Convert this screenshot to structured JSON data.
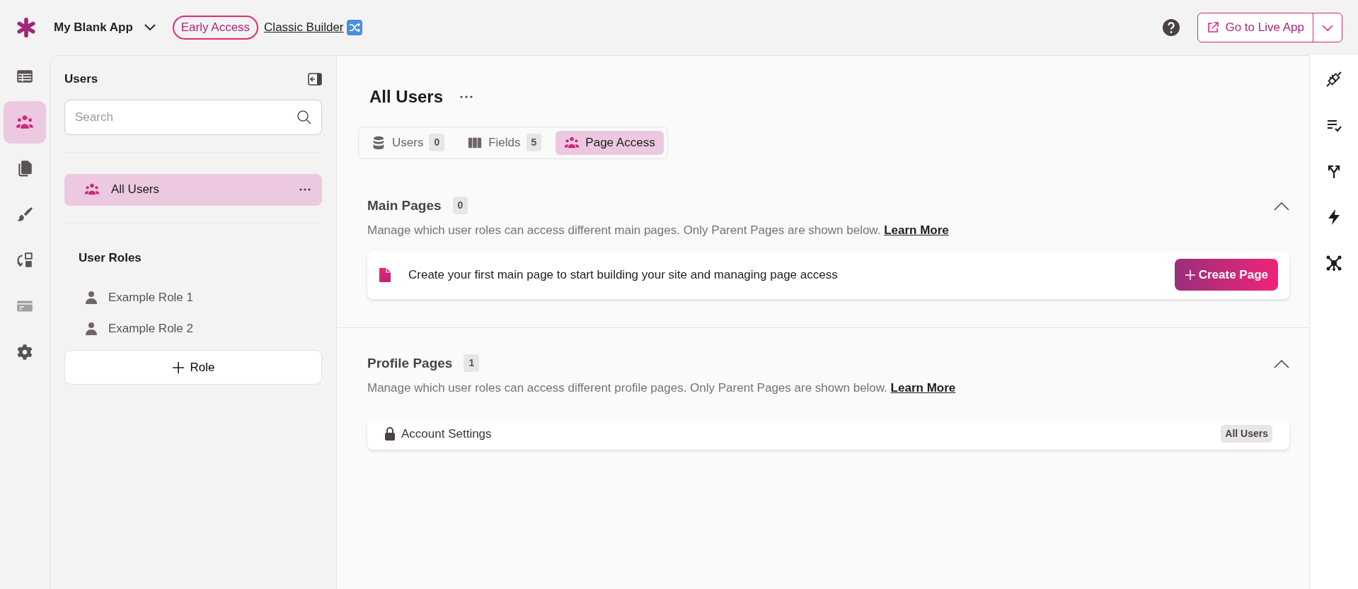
{
  "header": {
    "app_name": "My Blank App",
    "badge": "Early Access",
    "classic_link": "Classic Builder",
    "live_button": "Go to Live App"
  },
  "left_rail": [
    {
      "kind": "table",
      "selected": false
    },
    {
      "kind": "users",
      "selected": true
    },
    {
      "kind": "pages",
      "selected": false
    },
    {
      "kind": "brush",
      "selected": false
    },
    {
      "kind": "flows",
      "selected": false
    },
    {
      "kind": "card",
      "selected": false
    },
    {
      "kind": "gear",
      "selected": false
    }
  ],
  "sidebar": {
    "title": "Users",
    "search": {
      "placeholder": "Search"
    },
    "groups": [
      {
        "label": "All Users",
        "selected": true
      }
    ],
    "roles_title": "User Roles",
    "roles": [
      {
        "label": "Example Role 1"
      },
      {
        "label": "Example Role 2"
      }
    ],
    "add_role": "Role"
  },
  "main": {
    "title": "All Users",
    "tabs": [
      {
        "kind": "database",
        "label": "Users",
        "count": "0",
        "selected": false
      },
      {
        "kind": "columns",
        "label": "Fields",
        "count": "5",
        "selected": false
      },
      {
        "kind": "users",
        "label": "Page Access",
        "selected": true
      }
    ],
    "sections": [
      {
        "title": "Main Pages",
        "count": "0",
        "expanded": true,
        "description": "Manage which user roles can access different main pages. Only Parent Pages are shown below.",
        "link": "Learn More",
        "empty": {
          "text": "Create your first main page to start building your site and managing page access",
          "button": "Create Page"
        }
      },
      {
        "title": "Profile Pages",
        "count": "1",
        "expanded": true,
        "description": "Manage which user roles can access different profile pages. Only Parent Pages are shown below.",
        "link": "Learn More",
        "pages": [
          {
            "name": "Account Settings",
            "locked": true,
            "access": "All Users"
          }
        ]
      }
    ]
  },
  "right_rail": [
    {
      "kind": "plug"
    },
    {
      "kind": "checklist"
    },
    {
      "kind": "split"
    },
    {
      "kind": "bolt"
    },
    {
      "kind": "network"
    }
  ]
}
